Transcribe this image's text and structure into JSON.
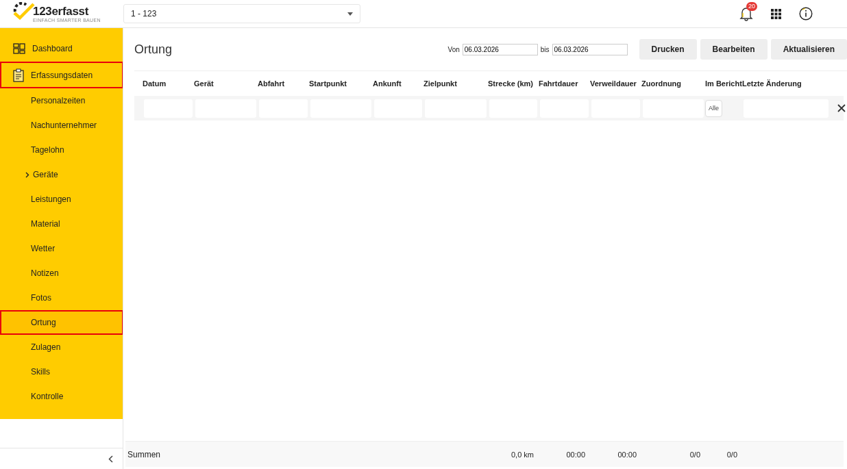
{
  "header": {
    "logo": {
      "name": "123erfasst",
      "tagline": "EINFACH SMARTER BAUEN"
    },
    "project_select": {
      "value": "1 - 123"
    },
    "notifications": {
      "count": "20"
    }
  },
  "sidebar": {
    "items": [
      {
        "label": "Dashboard",
        "kind": "main",
        "selected": false
      },
      {
        "label": "Erfassungsdaten",
        "kind": "main",
        "selected": true
      },
      {
        "label": "Personalzeiten",
        "kind": "sub",
        "selected": false
      },
      {
        "label": "Nachunternehmer",
        "kind": "sub",
        "selected": false
      },
      {
        "label": "Tagelohn",
        "kind": "sub",
        "selected": false
      },
      {
        "label": "Geräte",
        "kind": "group",
        "expanded": false,
        "selected": false
      },
      {
        "label": "Leistungen",
        "kind": "sub",
        "selected": false
      },
      {
        "label": "Material",
        "kind": "sub",
        "selected": false
      },
      {
        "label": "Wetter",
        "kind": "sub",
        "selected": false
      },
      {
        "label": "Notizen",
        "kind": "sub",
        "selected": false
      },
      {
        "label": "Fotos",
        "kind": "sub",
        "selected": false
      },
      {
        "label": "Ortung",
        "kind": "sub",
        "selected": true
      },
      {
        "label": "Zulagen",
        "kind": "sub",
        "selected": false
      },
      {
        "label": "Skills",
        "kind": "sub",
        "selected": false
      },
      {
        "label": "Kontrolle",
        "kind": "sub",
        "selected": false
      }
    ]
  },
  "page": {
    "title": "Ortung",
    "from_label": "Von",
    "from": "06.03.2026",
    "to_label": "bis",
    "to": "06.03.2026",
    "buttons": [
      "Drucken",
      "Bearbeiten",
      "Aktualisieren"
    ]
  },
  "table": {
    "columns": [
      {
        "label": "Datum",
        "kind": "text"
      },
      {
        "label": "Gerät",
        "kind": "text"
      },
      {
        "label": "Abfahrt",
        "kind": "text"
      },
      {
        "label": "Startpunkt",
        "kind": "text"
      },
      {
        "label": "Ankunft",
        "kind": "text"
      },
      {
        "label": "Zielpunkt",
        "kind": "text"
      },
      {
        "label": "Strecke (km)",
        "kind": "text",
        "sum": "0,0 km"
      },
      {
        "label": "Fahrtdauer",
        "kind": "text",
        "sum": "00:00"
      },
      {
        "label": "Verweildauer",
        "kind": "text",
        "sum": "00:00"
      },
      {
        "label": "Zuordnung",
        "kind": "text",
        "sum": "0/0"
      },
      {
        "label": "Im Bericht",
        "kind": "select",
        "value": "Alle",
        "sum": "0/0"
      },
      {
        "label": "Letzte Änderung",
        "kind": "text"
      }
    ],
    "sums_label": "Summen"
  }
}
